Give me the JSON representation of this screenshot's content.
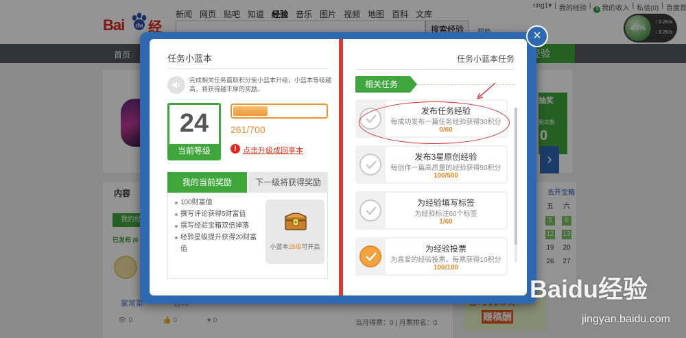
{
  "site": {
    "logo_bai": "Bai",
    "logo_jy": "经验",
    "nav": [
      "新闻",
      "网页",
      "贴吧",
      "知道",
      "经验",
      "音乐",
      "图片",
      "视频",
      "地图",
      "百科",
      "文库"
    ],
    "search_button": "搜索经验",
    "help": "帮助",
    "user_links": [
      "ring1▾",
      "|",
      "我的经验",
      "|",
      "我的收入",
      "|",
      "私信(0)",
      "|",
      "百度首页"
    ],
    "speed_value": "45%",
    "speed_up": "0.2K/s",
    "speed_down": "0.2K/s",
    "home_tab": "首页",
    "green_tab": "经验",
    "lottery_title": "抽奖",
    "lottery_sub": "剩次数",
    "lottery_num": "0",
    "content_label": "内容",
    "my_btn": "我的经",
    "published": "已发布 (6",
    "row_author": "家常菜",
    "row_cat": "百科",
    "row_views": "0",
    "row_votes": "0",
    "row_likes": "0",
    "rank_text": "当月得票：0 | 月票排名：0",
    "cal_header": "去开宝箱",
    "cal_days": [
      "五",
      "六",
      "5",
      "6",
      "12",
      "13",
      "19",
      "20",
      "26",
      "27"
    ],
    "ad_line1": "老司机带你",
    "ad_line2": "赚稿酬",
    "watermark": "Baidu经验",
    "watermark_url": "jingyan.baidu.com"
  },
  "modal": {
    "left_title": "任务小蓝本",
    "intro": "完成相关任务赢取积分使小蓝本升级，小蓝本等级越高，将获得越丰厚的奖励。",
    "level": "24",
    "level_label": "当前等级",
    "xp_text": "261/700",
    "progress": 0.37,
    "upgrade_link": "点击升级成回享本",
    "tab_current": "我的当前奖励",
    "tab_next": "下一级将获得奖励",
    "rewards": [
      "100财富值",
      "撰写评论获得5财富值",
      "撰写经验宝箱双倍掉落",
      "经验星级提升获得20财富值"
    ],
    "chest_caption_pre": "小蓝本",
    "chest_caption_hl": "25级",
    "chest_caption_post": "可开启",
    "right_title": "任务小蓝本任务",
    "related": "相关任务",
    "tasks": [
      {
        "title": "发布任务经验",
        "desc": "每成功发布一篇任务经验获得30积分",
        "progress": "0/60",
        "done": false
      },
      {
        "title": "发布3星原创经验",
        "desc": "每创作一篇高质量的经验获得50积分",
        "progress": "100/500",
        "done": false
      },
      {
        "title": "为经验填写标签",
        "desc": "为经验标注60个标签",
        "progress": "1/60",
        "done": false
      },
      {
        "title": "为经验投票",
        "desc": "为喜爱的经验投票，每票获得10积分",
        "progress": "100/100",
        "done": true
      }
    ],
    "close": "×"
  },
  "colors": {
    "blue": "#2e68b0",
    "green": "#3fa63b",
    "orange": "#e88a2d",
    "red": "#d83b35"
  }
}
